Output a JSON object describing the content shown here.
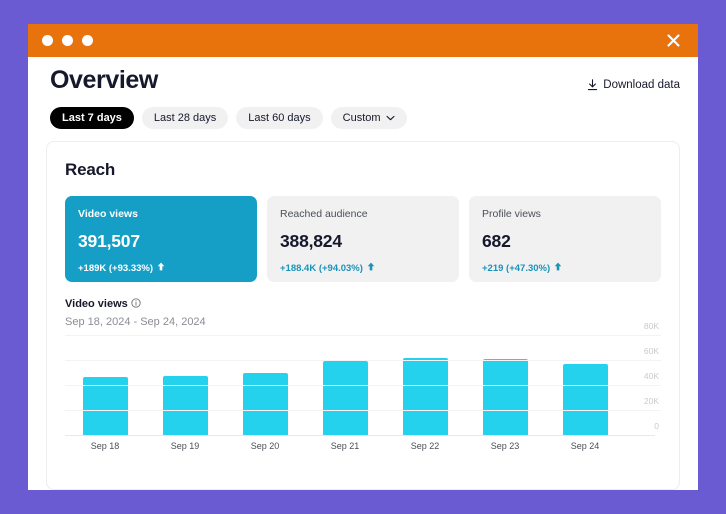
{
  "window": {
    "titlebar": {
      "dots": [
        "red-dot",
        "yellow-dot",
        "green-dot"
      ],
      "close_label": "×"
    }
  },
  "header": {
    "title": "Overview",
    "download_label": "Download data"
  },
  "filters": [
    {
      "label": "Last 7 days",
      "active": true,
      "has_chevron": false
    },
    {
      "label": "Last 28 days",
      "active": false,
      "has_chevron": false
    },
    {
      "label": "Last 60 days",
      "active": false,
      "has_chevron": false
    },
    {
      "label": "Custom",
      "active": false,
      "has_chevron": true
    }
  ],
  "reach": {
    "section_title": "Reach",
    "metrics": [
      {
        "label": "Video views",
        "value": "391,507",
        "delta": "+189K  (+93.33%)",
        "trend": "up",
        "selected": true
      },
      {
        "label": "Reached audience",
        "value": "388,824",
        "delta": "+188.4K  (+94.03%)",
        "trend": "up",
        "selected": false
      },
      {
        "label": "Profile views",
        "value": "682",
        "delta": "+219  (+47.30%)",
        "trend": "up",
        "selected": false
      }
    ]
  },
  "chart_header": {
    "title": "Video views",
    "info_icon": "info-icon",
    "range": "Sep 18, 2024 - Sep 24, 2024"
  },
  "chart_data": {
    "type": "bar",
    "title": "Video views",
    "subtitle": "Sep 18, 2024 - Sep 24, 2024",
    "xlabel": "",
    "ylabel": "",
    "categories": [
      "Sep 18",
      "Sep 19",
      "Sep 20",
      "Sep 21",
      "Sep 22",
      "Sep 23",
      "Sep 24"
    ],
    "values": [
      47000,
      48000,
      50000,
      60000,
      62000,
      61000,
      57000
    ],
    "ylim": [
      0,
      80000
    ],
    "yticks": [
      0,
      20000,
      40000,
      60000,
      80000
    ],
    "ytick_labels": [
      "0",
      "20K",
      "40K",
      "60K",
      "80K"
    ],
    "grid": true,
    "legend": "none",
    "bar_color": "#25d2ee"
  },
  "colors": {
    "page_background": "#6b5bd2",
    "titlebar": "#e8730c",
    "accent_selected_card": "#169fc6",
    "bar": "#25d2ee",
    "delta_text": "#1b93b8",
    "pill_active": "#000000",
    "pill_inactive": "#f1f1f2"
  }
}
